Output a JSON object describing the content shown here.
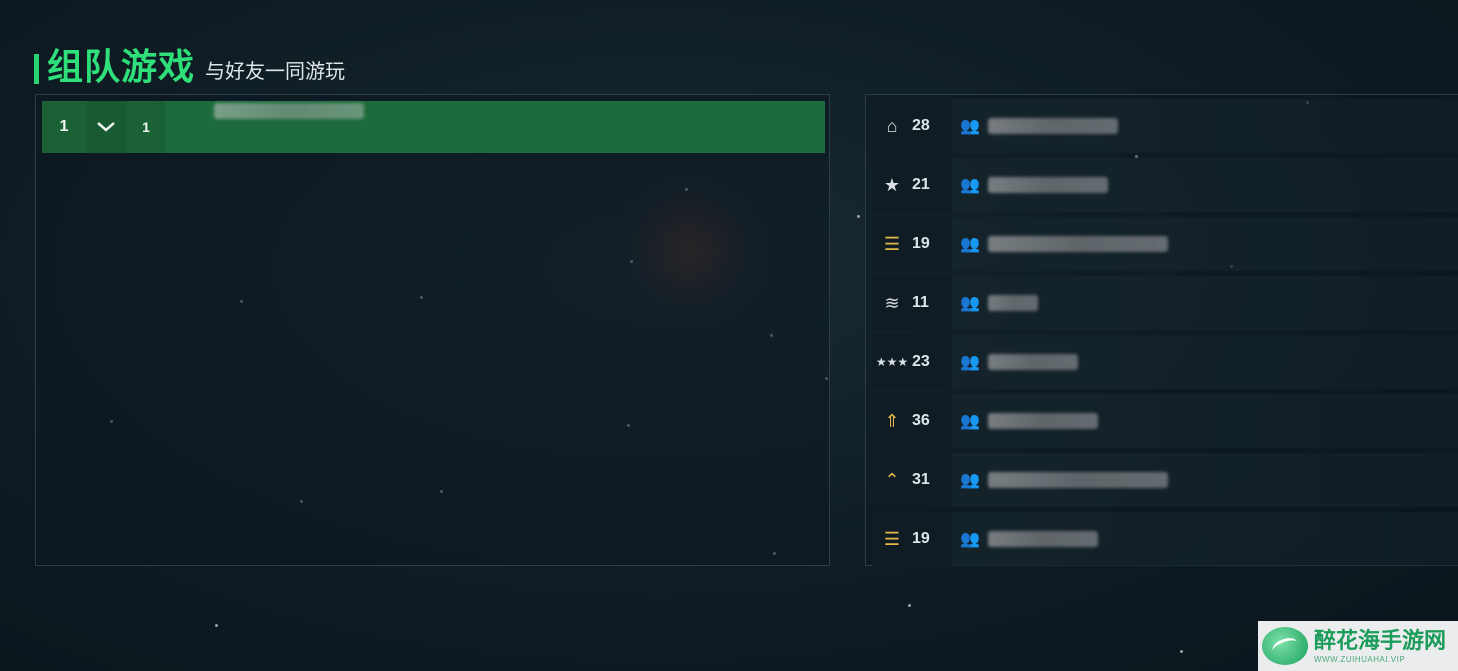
{
  "header": {
    "title": "组队游戏",
    "subtitle": "与好友一同游玩"
  },
  "team": {
    "number": "1",
    "expand_icon": "chevron-down-icon",
    "member_count": "1"
  },
  "players": [
    {
      "rank_icon": "rank-chevron-icon",
      "level": "28"
    },
    {
      "rank_icon": "rank-star-icon",
      "level": "21"
    },
    {
      "rank_icon": "rank-bars-icon",
      "level": "19"
    },
    {
      "rank_icon": "rank-stripes-icon",
      "level": "11"
    },
    {
      "rank_icon": "rank-three-star-icon",
      "level": "23"
    },
    {
      "rank_icon": "rank-gold-chevron-icon",
      "level": "36"
    },
    {
      "rank_icon": "rank-gold-arch-icon",
      "level": "31"
    },
    {
      "rank_icon": "rank-bars-icon",
      "level": "19"
    }
  ],
  "watermark": {
    "title": "醉花海手游网",
    "url": "WWW.ZUIHUAHAI.VIP"
  },
  "colors": {
    "accent_green": "#2fe07a",
    "team_row": "#1d6b3c",
    "panel_border": "#2a3e48"
  }
}
